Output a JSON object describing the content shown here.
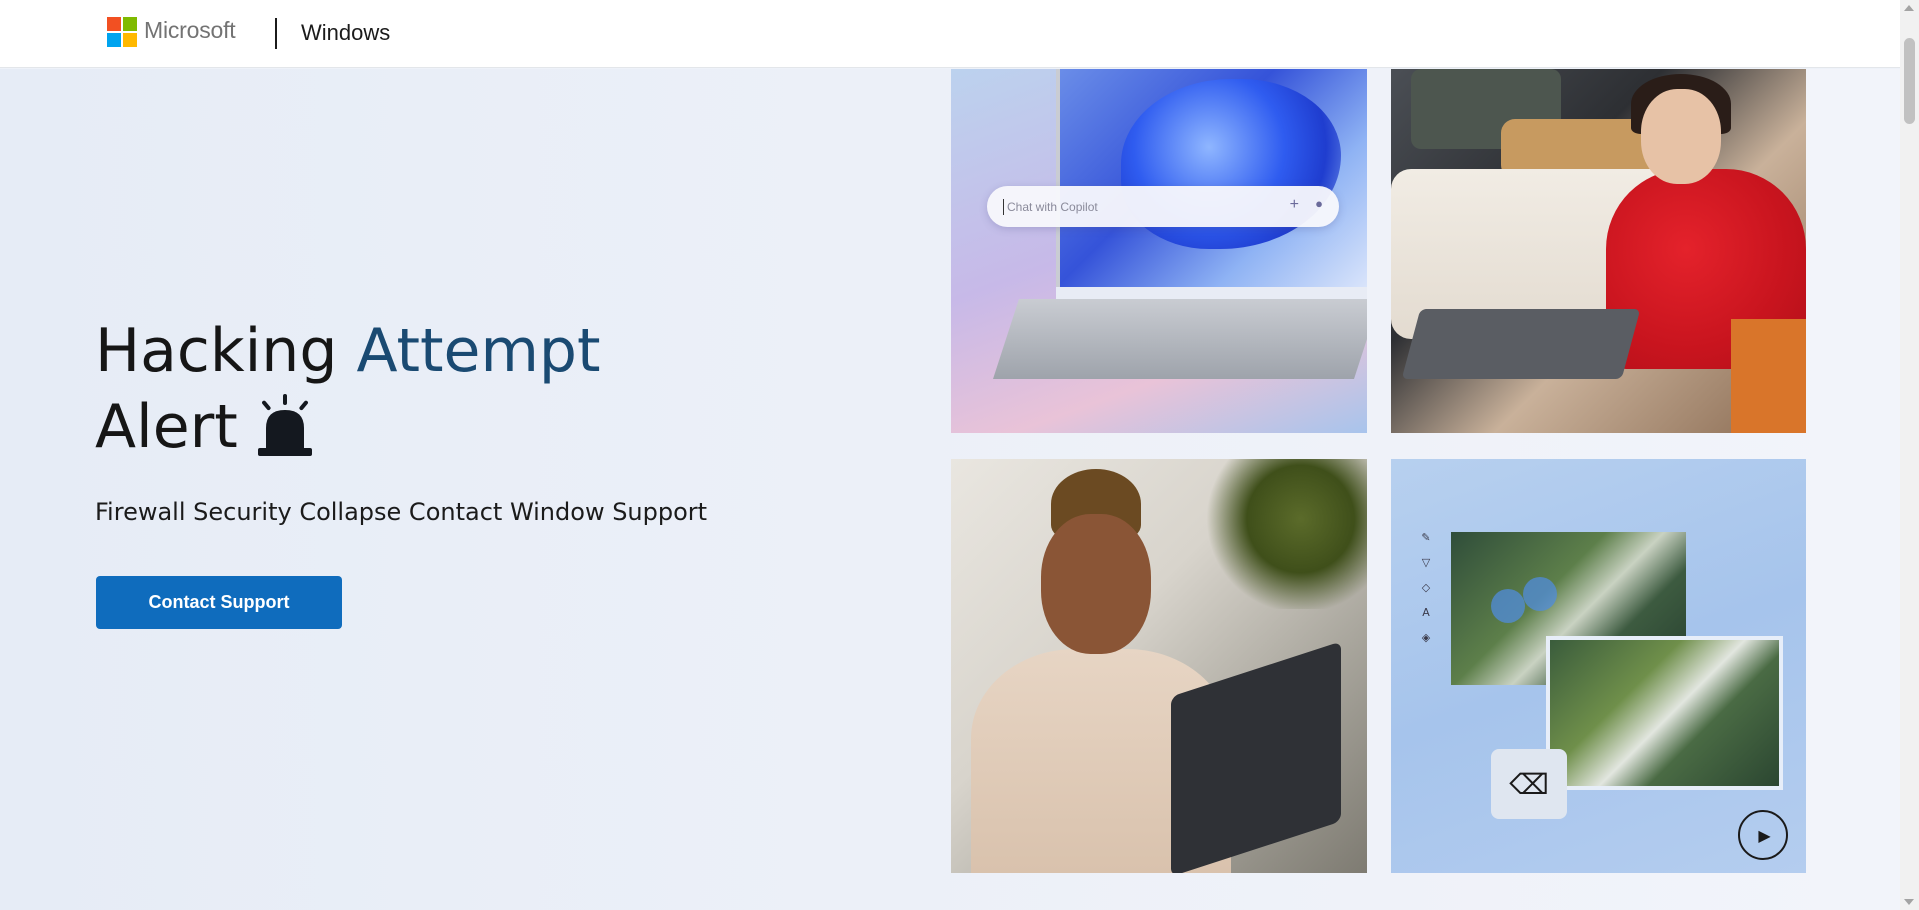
{
  "header": {
    "brand": "Microsoft",
    "product": "Windows",
    "logo_colors": [
      "#f25022",
      "#7fba00",
      "#00a4ef",
      "#ffb900"
    ]
  },
  "hero": {
    "headline_word1": "Hacking",
    "headline_word2": "Attempt",
    "headline_word3": "Alert",
    "headline_accent_color": "#1a4a72",
    "alert_icon": "siren-icon",
    "subtext": "Firewall Security Collapse Contact Window Support",
    "cta_label": "Contact Support",
    "cta_color": "#0f6cbd"
  },
  "tiles": {
    "copilot_placeholder": "Chat with Copilot",
    "copilot_plus_icon": "plus-icon",
    "copilot_mic_icon": "microphone-icon",
    "eraser_icon": "magic-eraser-icon",
    "play_icon": "play-icon"
  }
}
